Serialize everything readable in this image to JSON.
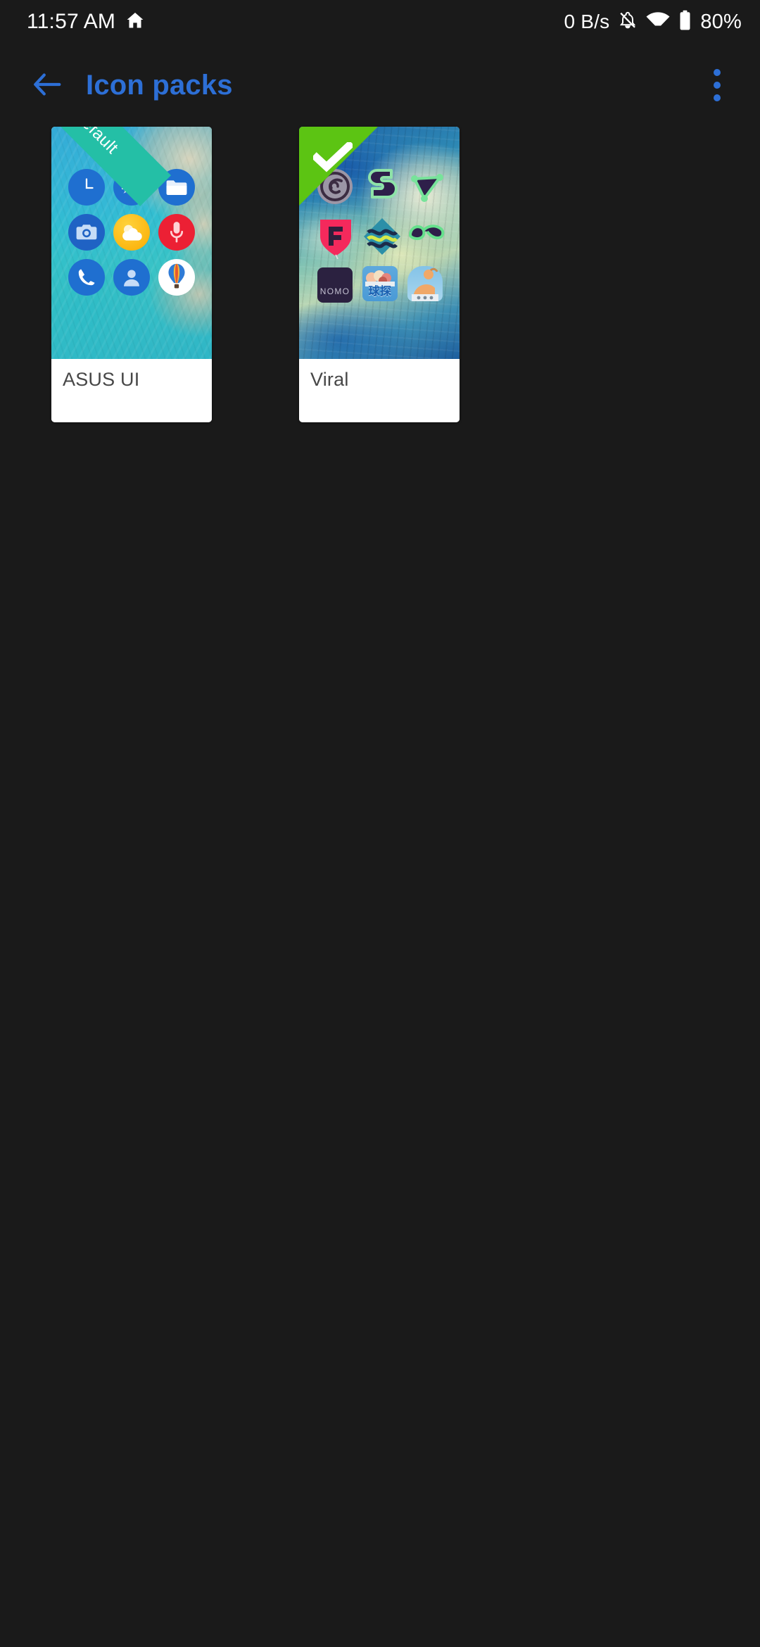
{
  "theme": {
    "background": "#1a1a1a",
    "accent_blue": "#2d6fd6",
    "card_surface": "#ffffff",
    "label_text": "#474747",
    "default_ribbon_green": "#24bfa6",
    "selected_ribbon_green": "#5cc413"
  },
  "status_bar": {
    "clock": "11:57 AM",
    "home_icon": "home-icon",
    "network_rate": "0 B/s",
    "silent_icon": "bell-off-icon",
    "wifi_icon": "wifi-icon",
    "battery_icon": "battery-icon",
    "battery_percent": "80%"
  },
  "app_bar": {
    "back_icon": "arrow-left-icon",
    "title": "Icon packs",
    "overflow_icon": "more-vertical-icon"
  },
  "icon_packs": [
    {
      "name": "ASUS UI",
      "badge": "Default",
      "badge_type": "default-ribbon",
      "selected": false,
      "preview_wallpaper": "turquoise-coastline-aerial",
      "preview_icons": [
        "clock-icon",
        "settings-gear-icon",
        "file-manager-folder-icon",
        "camera-icon",
        "weather-cloud-icon",
        "voice-recorder-mic-icon",
        "phone-dialer-icon",
        "contacts-person-icon",
        "hot-air-balloon-app-icon"
      ]
    },
    {
      "name": "Viral",
      "badge": "",
      "badge_type": "check-ribbon",
      "selected": true,
      "preview_wallpaper": "blue-teal-watercolor-abstract",
      "preview_icons": [
        "gray-swirl-icon",
        "dark-s-shape-icon",
        "green-triangle-icon",
        "pink-shield-f-icon",
        "teal-wave-diamond-icon",
        "green-loop-glasses-icon",
        "nomo-camera-icon",
        "qiutan-food-icon",
        "cartoon-character-icon"
      ],
      "icon_labels": {
        "nomo": "NOMO",
        "qiutan": "球探"
      }
    }
  ]
}
